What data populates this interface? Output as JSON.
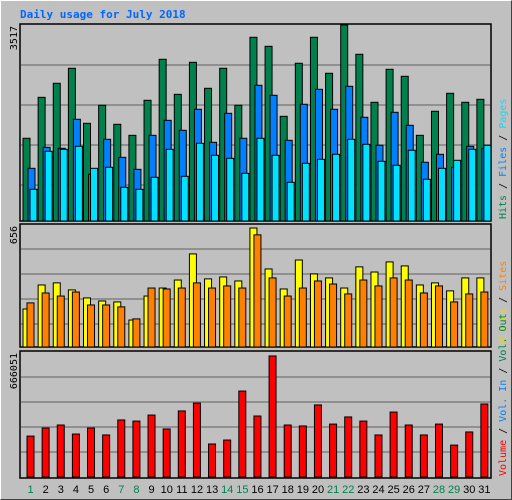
{
  "chart_data": {
    "type": "bar",
    "title": "Daily usage for July 2018",
    "categories": [
      "1",
      "2",
      "3",
      "4",
      "5",
      "6",
      "7",
      "8",
      "9",
      "10",
      "11",
      "12",
      "13",
      "14",
      "15",
      "16",
      "17",
      "18",
      "19",
      "20",
      "21",
      "22",
      "23",
      "24",
      "25",
      "26",
      "27",
      "28",
      "29",
      "30",
      "31"
    ],
    "weekend_days": [
      "1",
      "7",
      "8",
      "14",
      "15",
      "21",
      "22",
      "28",
      "29"
    ],
    "colors": {
      "hits": "#00804d",
      "files": "#0080ff",
      "pages": "#00e0ff",
      "visits": "#ffff00",
      "sites": "#ff8000",
      "volume": "#ff0000",
      "vol_in": "#0080ff",
      "vol_out": "#00804d",
      "weekend_label": "#00804d",
      "weekday_label": "#000000",
      "title": "#0066ff"
    },
    "panels": [
      {
        "name": "hits-files-pages",
        "ymax_label": "3517",
        "ylim": [
          0,
          3517
        ],
        "legend": [
          {
            "text": "Hits",
            "color": "#00804d"
          },
          {
            "text": " / ",
            "color": "#000000"
          },
          {
            "text": "Files",
            "color": "#0080ff"
          },
          {
            "text": " / ",
            "color": "#000000"
          },
          {
            "text": "Pages",
            "color": "#00e0ff"
          }
        ],
        "series": [
          {
            "name": "Hits",
            "key": "hits",
            "values": [
              1525,
              2245,
              2492,
              2756,
              1788,
              2105,
              1771,
              1577,
              2193,
              2914,
              2298,
              2861,
              2404,
              2756,
              2105,
              3301,
              3142,
              1911,
              2844,
              3301,
              2668,
              3517,
              3002,
              2158,
              2738,
              2615,
              1577,
              2000,
              2316,
              2158,
              2210
            ]
          },
          {
            "name": "Files",
            "key": "files",
            "values": [
              997,
              1366,
              1349,
              1859,
              892,
              1507,
              1190,
              979,
              1577,
              1841,
              1665,
              2035,
              1454,
              1964,
              1525,
              2457,
              2281,
              1489,
              2123,
              2386,
              2035,
              2439,
              1894,
              1402,
              1982,
              1753,
              1103,
              1243,
              1015,
              1384,
              1349
            ]
          },
          {
            "name": "Pages",
            "key": "pages",
            "values": [
              628,
              1296,
              1331,
              1384,
              997,
              1015,
              663,
              628,
              839,
              1331,
              856,
              1437,
              1226,
              1173,
              909,
              1525,
              1226,
              751,
              1085,
              1155,
              1243,
              1507,
              1419,
              1120,
              1050,
              1314,
              804,
              997,
              1138,
              1331,
              1402
            ]
          }
        ]
      },
      {
        "name": "visits-sites",
        "ymax_label": "656",
        "ylim": [
          0,
          656
        ],
        "legend": [
          {
            "text": "Visits",
            "color": "#e0e000"
          },
          {
            "text": " / ",
            "color": "#000000"
          },
          {
            "text": "Sites",
            "color": "#ff8000"
          }
        ],
        "series": [
          {
            "name": "Visits",
            "key": "visits",
            "values": [
              210,
              336,
              347,
              310,
              268,
              252,
              247,
              152,
              278,
              320,
              362,
              499,
              368,
              378,
              357,
              635,
              420,
              315,
              467,
              394,
              373,
              320,
              431,
              404,
              457,
              436,
              336,
              347,
              305,
              373,
              373
            ]
          },
          {
            "name": "Sites",
            "key": "sites",
            "values": [
              242,
              294,
              278,
              299,
              231,
              231,
              221,
              158,
              320,
              315,
              320,
              347,
              320,
              331,
              320,
              599,
              373,
              278,
              320,
              357,
              341,
              289,
              362,
              331,
              373,
              362,
              294,
              331,
              247,
              289,
              299
            ]
          }
        ]
      },
      {
        "name": "volume",
        "ymax_label": "666051",
        "ylim": [
          0,
          666051
        ],
        "legend": [
          {
            "text": "Volume",
            "color": "#ff0000"
          },
          {
            "text": " / ",
            "color": "#000000"
          },
          {
            "text": "Vol. In",
            "color": "#0080ff"
          },
          {
            "text": " / ",
            "color": "#000000"
          },
          {
            "text": "Vol. Out",
            "color": "#00804d"
          }
        ],
        "series": [
          {
            "name": "Volume",
            "key": "volume",
            "values": [
              218000,
              261000,
              277000,
              229000,
              261000,
              224000,
              304000,
              298000,
              330000,
              256000,
              352000,
              394000,
              176000,
              197000,
              458000,
              325000,
              645000,
              277000,
              272000,
              384000,
              282000,
              320000,
              298000,
              224000,
              346000,
              277000,
              224000,
              282000,
              170000,
              240000,
              389000
            ]
          }
        ]
      }
    ],
    "grid": true,
    "gridlines_per_panel": 4
  }
}
